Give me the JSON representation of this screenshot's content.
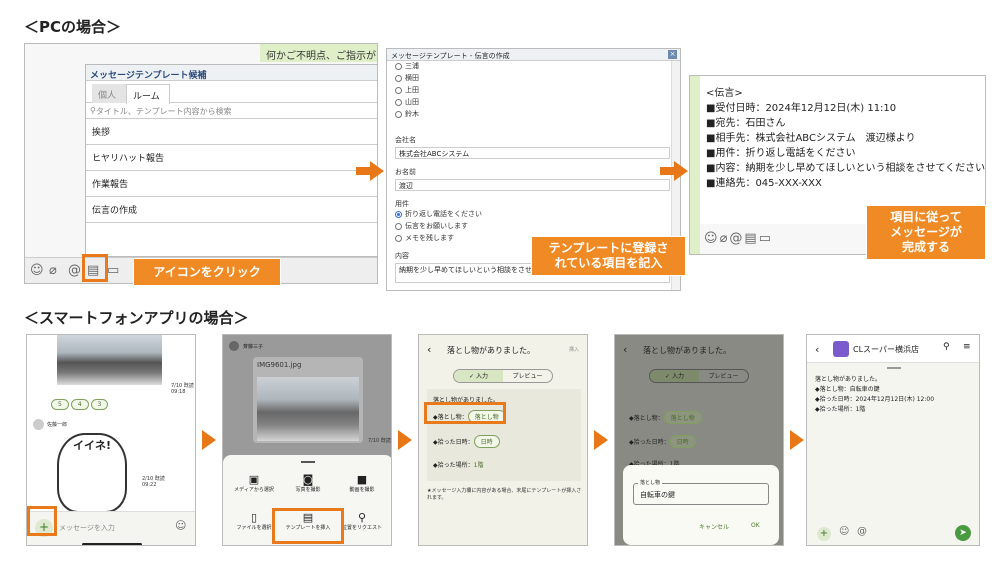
{
  "headings": {
    "pc": "＜PCの場合＞",
    "smartphone": "＜スマートフォンアプリの場合＞"
  },
  "pc1": {
    "banner": "何かご不明点、ご指示がご",
    "popup_title": "メッセージテンプレート候補",
    "tabs": [
      "個人",
      "ルーム"
    ],
    "search_placeholder": "タイトル、テンプレート内容から検索",
    "items": [
      "挨拶",
      "ヒヤリハット報告",
      "作業報告",
      "伝言の作成"
    ],
    "callout": "アイコンをクリック"
  },
  "pc2": {
    "title": "メッセージテンプレート - 伝言の作成",
    "names": [
      "三浦",
      "横田",
      "上田",
      "山田",
      "鈴木"
    ],
    "company_label": "会社名",
    "company_value": "株式会社ABCシステム",
    "name_label": "お名前",
    "name_value": "渡辺",
    "purpose_label": "用件",
    "purpose_options": [
      "折り返し電話をください",
      "伝言をお願いします",
      "メモを残します"
    ],
    "content_label": "内容",
    "content_value": "納期を少し早めてほしいという相談をさせて",
    "callout": "テンプレートに登録さ\nれている項目を記入"
  },
  "pc3": {
    "lines": [
      "<伝言>",
      "■受付日時：2024年12月12日(木) 11:10",
      "■宛先：石田さん",
      "■相手先：株式会社ABCシステム　渡辺様より",
      "■用件：折り返し電話をください",
      "■内容：納期を少し早めてほしいという相談をさせてください。",
      "■連絡先：045-XXX-XXX"
    ],
    "callout": "項目に従って\nメッセージが\n完成する"
  },
  "sp1": {
    "time1": "7/10 既読",
    "time1b": "09:18",
    "reactions": [
      "5",
      "4",
      "3"
    ],
    "sender": "佐藤一郎",
    "sticker_text": "イイネ!",
    "time2": "2/10 既読",
    "time2b": "09:22",
    "input_placeholder": "メッセージを入力"
  },
  "sp2": {
    "sender": "斉藤三子",
    "file": "IMG9601.jpg",
    "time": "7/10 既読",
    "menu": [
      "メディアから選択",
      "写真を撮影",
      "動画を撮影",
      "ファイルを選択",
      "テンプレートを挿入",
      "位置をリクエスト"
    ]
  },
  "sp3": {
    "title": "落とし物がありました。",
    "insert": "挿入",
    "tab_input": "✓ 入力",
    "tab_preview": "プレビュー",
    "body_title": "落とし物がありました。",
    "f1_label": "◆落とし物：",
    "f1_chip": "落とし物",
    "f2_label": "◆拾った日時：",
    "f2_chip": "日時",
    "f3_label": "◆拾った場所：",
    "f3_value": "1階",
    "note": "★メッセージ入力欄に内容がある場合、末尾にテンプレートが挿入されます。"
  },
  "sp4": {
    "title": "落とし物がありました。",
    "tab_input": "✓ 入力",
    "tab_preview": "プレビュー",
    "f1_label": "◆落とし物：",
    "f1_chip": "落とし物",
    "f2_label": "◆拾った日時：",
    "f2_chip": "日時",
    "f3_label": "◆拾った場所：",
    "f3_value": "1階",
    "dialog_label": "落とし物",
    "dialog_value": "自転車の鍵",
    "cancel": "キャンセル",
    "ok": "OK"
  },
  "sp5": {
    "room": "CLスーパー横浜店",
    "lines": [
      "落とし物がありました。",
      "◆落とし物：自転車の鍵",
      "◆拾った日時：2024年12月12日(木) 12:00",
      "◆拾った場所：1階"
    ]
  },
  "colors": {
    "accent": "#e97a1c",
    "green": "#4a9b3f",
    "header_bg": "#dff0c8"
  }
}
